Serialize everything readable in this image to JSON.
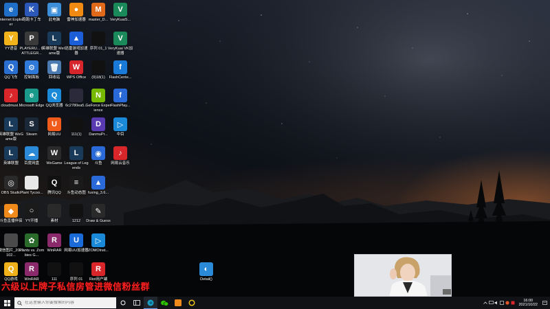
{
  "desktop": {
    "icons": [
      {
        "label": "Internet Explorer",
        "glyph": "e",
        "color": "#1f6fc9",
        "name": "internet-explorer-icon"
      },
      {
        "label": "跑跑卡丁车",
        "glyph": "K",
        "color": "#2b58b8",
        "name": "kartrider-icon"
      },
      {
        "label": "此电脑",
        "glyph": "▣",
        "color": "#3c8fd8",
        "name": "this-pc-icon"
      },
      {
        "label": "雷神加速器",
        "glyph": "●",
        "color": "#f08a12",
        "name": "leishen-accelerator-icon"
      },
      {
        "label": "master_D...",
        "glyph": "M",
        "color": "#e06a1a",
        "name": "master-d-icon"
      },
      {
        "label": "VeryKuaiS...",
        "glyph": "V",
        "color": "#1b8a5a",
        "name": "verykuai-icon"
      },
      {
        "label": "YY语音",
        "glyph": "Y",
        "color": "#f2b21a",
        "name": "yy-voice-icon"
      },
      {
        "label": "PLAYERU... BATTLEGR...",
        "glyph": "P",
        "color": "#3a3a3a",
        "name": "pubg-icon"
      },
      {
        "label": "英雄联盟 WeGame版",
        "glyph": "L",
        "color": "#1a3a5a",
        "name": "lol-wegame-icon"
      },
      {
        "label": "迅雷游戏加速器",
        "glyph": "▲",
        "color": "#1b5ed8",
        "name": "xunlei-accelerator-icon"
      },
      {
        "label": "序列 01_1",
        "glyph": "",
        "color": "#111111",
        "name": "sequence-01-1-icon"
      },
      {
        "label": "VeryKuai VK加速器",
        "glyph": "V",
        "color": "#1b8a5a",
        "name": "verykuai-vk-icon"
      },
      {
        "label": "QQ飞车",
        "glyph": "Q",
        "color": "#2a6fd0",
        "name": "qq-speed-icon"
      },
      {
        "label": "控制面板",
        "glyph": "⚙",
        "color": "#2f7ad8",
        "name": "control-panel-icon"
      },
      {
        "label": "回收站",
        "glyph": "🗑",
        "color": "#4a7ab0",
        "name": "recycle-bin-icon"
      },
      {
        "label": "WPS Office",
        "glyph": "W",
        "color": "#d6262b",
        "name": "wps-office-icon"
      },
      {
        "label": "(9)18(1)",
        "glyph": "",
        "color": "#111111",
        "name": "file-9181-icon"
      },
      {
        "label": "FlashCente...",
        "glyph": "f",
        "color": "#1a7ad8",
        "name": "flash-center-icon"
      },
      {
        "label": "cloudmusi...",
        "glyph": "♪",
        "color": "#d8262b",
        "name": "cloudmusic-icon"
      },
      {
        "label": "Microsoft Edge",
        "glyph": "e",
        "color": "#1a9a8a",
        "name": "edge-icon"
      },
      {
        "label": "QQ浏览器",
        "glyph": "Q",
        "color": "#1a8ad8",
        "name": "qq-browser-icon"
      },
      {
        "label": "6c2780ea5...",
        "glyph": "",
        "color": "#2a2a3a",
        "name": "file-6c2780-icon"
      },
      {
        "label": "GeForce Experience",
        "glyph": "N",
        "color": "#76b900",
        "name": "geforce-experience-icon"
      },
      {
        "label": "FlashPlay...",
        "glyph": "f",
        "color": "#2a6ad8",
        "name": "flash-player-icon"
      },
      {
        "label": "英雄联盟 WeGame版",
        "glyph": "L",
        "color": "#1a3a5a",
        "name": "lol-wegame-2-icon"
      },
      {
        "label": "Steam",
        "glyph": "S",
        "color": "#1b2838",
        "name": "steam-icon"
      },
      {
        "label": "网易UU",
        "glyph": "U",
        "color": "#f05a1a",
        "name": "netease-uu-icon"
      },
      {
        "label": "111(1)",
        "glyph": "",
        "color": "#111111",
        "name": "file-111-1-icon"
      },
      {
        "label": "DanmuPr...",
        "glyph": "D",
        "color": "#5a3ab0",
        "name": "danmu-pro-icon"
      },
      {
        "label": "中目",
        "glyph": "▷",
        "color": "#1a8ad8",
        "name": "zhongmu-icon"
      },
      {
        "label": "英雄联盟",
        "glyph": "L",
        "color": "#1a3a5a",
        "name": "lol-icon"
      },
      {
        "label": "百度网盘",
        "glyph": "☁",
        "color": "#2a8ad8",
        "name": "baidu-netdisk-icon"
      },
      {
        "label": "WeGame",
        "glyph": "W",
        "color": "#2a2a2a",
        "name": "wegame-icon"
      },
      {
        "label": "League of Legends",
        "glyph": "L",
        "color": "#1a3a5a",
        "name": "league-of-legends-icon"
      },
      {
        "label": "斗鱼",
        "glyph": "◉",
        "color": "#2a6ad8",
        "name": "douyu-icon"
      },
      {
        "label": "网易云音乐",
        "glyph": "♪",
        "color": "#d8262b",
        "name": "netease-music-icon"
      },
      {
        "label": "OBS Studio",
        "glyph": "◎",
        "color": "#2a2a2a",
        "name": "obs-studio-icon"
      },
      {
        "label": "Plant Tycoo...",
        "glyph": "",
        "color": "#e8e8e8",
        "name": "plant-tycoon-icon"
      },
      {
        "label": "腾讯QQ",
        "glyph": "Q",
        "color": "#111111",
        "name": "tencent-qq-icon"
      },
      {
        "label": "斗鱼动态图",
        "glyph": "≡",
        "color": "#1a1a1a",
        "name": "douyu-gif-icon"
      },
      {
        "label": "fuxing_3.6...",
        "glyph": "▲",
        "color": "#2a6ad8",
        "name": "fuxing-icon"
      },
      {
        "label": "斗鱼直播伴侣",
        "glyph": "◆",
        "color": "#f08a1a",
        "name": "douyu-companion-icon"
      },
      {
        "label": "YY开播",
        "glyph": "○",
        "color": "#1a1a1a",
        "name": "yy-live-icon"
      },
      {
        "label": "素材",
        "glyph": "",
        "color": "#2a2a2a",
        "name": "material-folder-icon"
      },
      {
        "label": "1212",
        "glyph": "",
        "color": "#111111",
        "name": "file-1212-icon"
      },
      {
        "label": "Draw & Guess",
        "glyph": "✎",
        "color": "#2a2a2a",
        "name": "draw-guess-icon"
      },
      {
        "label": "微信图片_2021102...",
        "glyph": "",
        "color": "#4a4a4a",
        "name": "wechat-image-icon"
      },
      {
        "label": "Plants vs. Zombies G...",
        "glyph": "✿",
        "color": "#2a6a2a",
        "name": "pvz-icon"
      },
      {
        "label": "WinRAR",
        "glyph": "R",
        "color": "#8a2a6a",
        "name": "winrar-icon"
      },
      {
        "label": "网易UU加速器",
        "glyph": "U",
        "color": "#1a6ad8",
        "name": "netease-uu-accelerator-icon"
      },
      {
        "label": "ZOMOlnst...",
        "glyph": "▷",
        "color": "#1a8ad8",
        "name": "zomo-icon"
      },
      {
        "label": "QQ游戏",
        "glyph": "Q",
        "color": "#f0b01a",
        "name": "qq-game-icon"
      },
      {
        "label": "WinRAR",
        "glyph": "R",
        "color": "#8a2a6a",
        "name": "winrar-2-icon"
      },
      {
        "label": "111",
        "glyph": "",
        "color": "#111111",
        "name": "file-111-icon"
      },
      {
        "label": "序列 01",
        "glyph": "",
        "color": "#111111",
        "name": "sequence-01-icon"
      },
      {
        "label": "Riot用户端",
        "glyph": "R",
        "color": "#d8262b",
        "name": "riot-client-icon"
      },
      {
        "label": "Detail()",
        "glyph": "◐",
        "color": "#2a8ad8",
        "name": "detail-icon"
      }
    ]
  },
  "overlay": {
    "banner": "六级以上牌子私信房管进微信粉丝群"
  },
  "taskbar": {
    "search_placeholder": "在这里输入你要搜索的内容",
    "clock_time": "16:00",
    "clock_date": "2021/10/22"
  },
  "colors": {
    "taskbar_bg": "#101216",
    "banner": "#ff2020",
    "active_underline": "#6aa5ff"
  }
}
